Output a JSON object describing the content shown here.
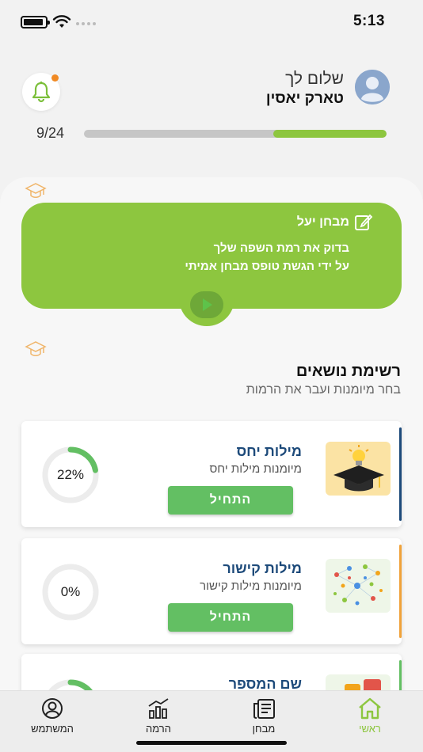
{
  "status_bar": {
    "time": "5:13"
  },
  "header": {
    "greeting": "שלום לך",
    "user_name": "טארק יאסין",
    "notification_icon": "bell-icon",
    "avatar_icon": "user-avatar-icon"
  },
  "progress": {
    "label": "9/24",
    "completed": 9,
    "total": 24
  },
  "exam_card": {
    "title": "מבחן יעל",
    "description_line1": "בדוק את רמת השפה שלך",
    "description_line2": "על ידי הגשת טופס מבחן אמיתי",
    "icon": "exam-edit-icon",
    "play_icon": "play-icon"
  },
  "topics": {
    "title": "רשימת נושאים",
    "subtitle": "בחר מיומנות ועבר את הרמות",
    "items": [
      {
        "name": "מילות יחס",
        "description": "מיומנות מילות יחס",
        "button": "התחיל",
        "progress_label": "22%",
        "progress": 0.22,
        "accent": "#1d4a7a",
        "thumb_icon": "graduation-lightbulb-icon"
      },
      {
        "name": "מילות קישור",
        "description": "מיומנות מילות קישור",
        "button": "התחיל",
        "progress_label": "0%",
        "progress": 0,
        "accent": "#f0a23a",
        "thumb_icon": "network-nodes-icon"
      },
      {
        "name": "שם המספר",
        "description": "",
        "button": "",
        "progress_label": "",
        "progress": 0.22,
        "accent": "#63bf63",
        "thumb_icon": "numbers-icon"
      }
    ]
  },
  "tabbar": {
    "tabs": [
      {
        "label": "ראשי",
        "icon": "home-icon",
        "active": true
      },
      {
        "label": "מבחן",
        "icon": "exam-icon",
        "active": false
      },
      {
        "label": "הרמה",
        "icon": "chart-icon",
        "active": false
      },
      {
        "label": "המשתמש",
        "icon": "user-icon",
        "active": false
      }
    ]
  },
  "colors": {
    "primary_green": "#8dc63f",
    "button_green": "#63bf63",
    "notification_dot": "#f08a24",
    "title_blue": "#1d4a7a"
  }
}
